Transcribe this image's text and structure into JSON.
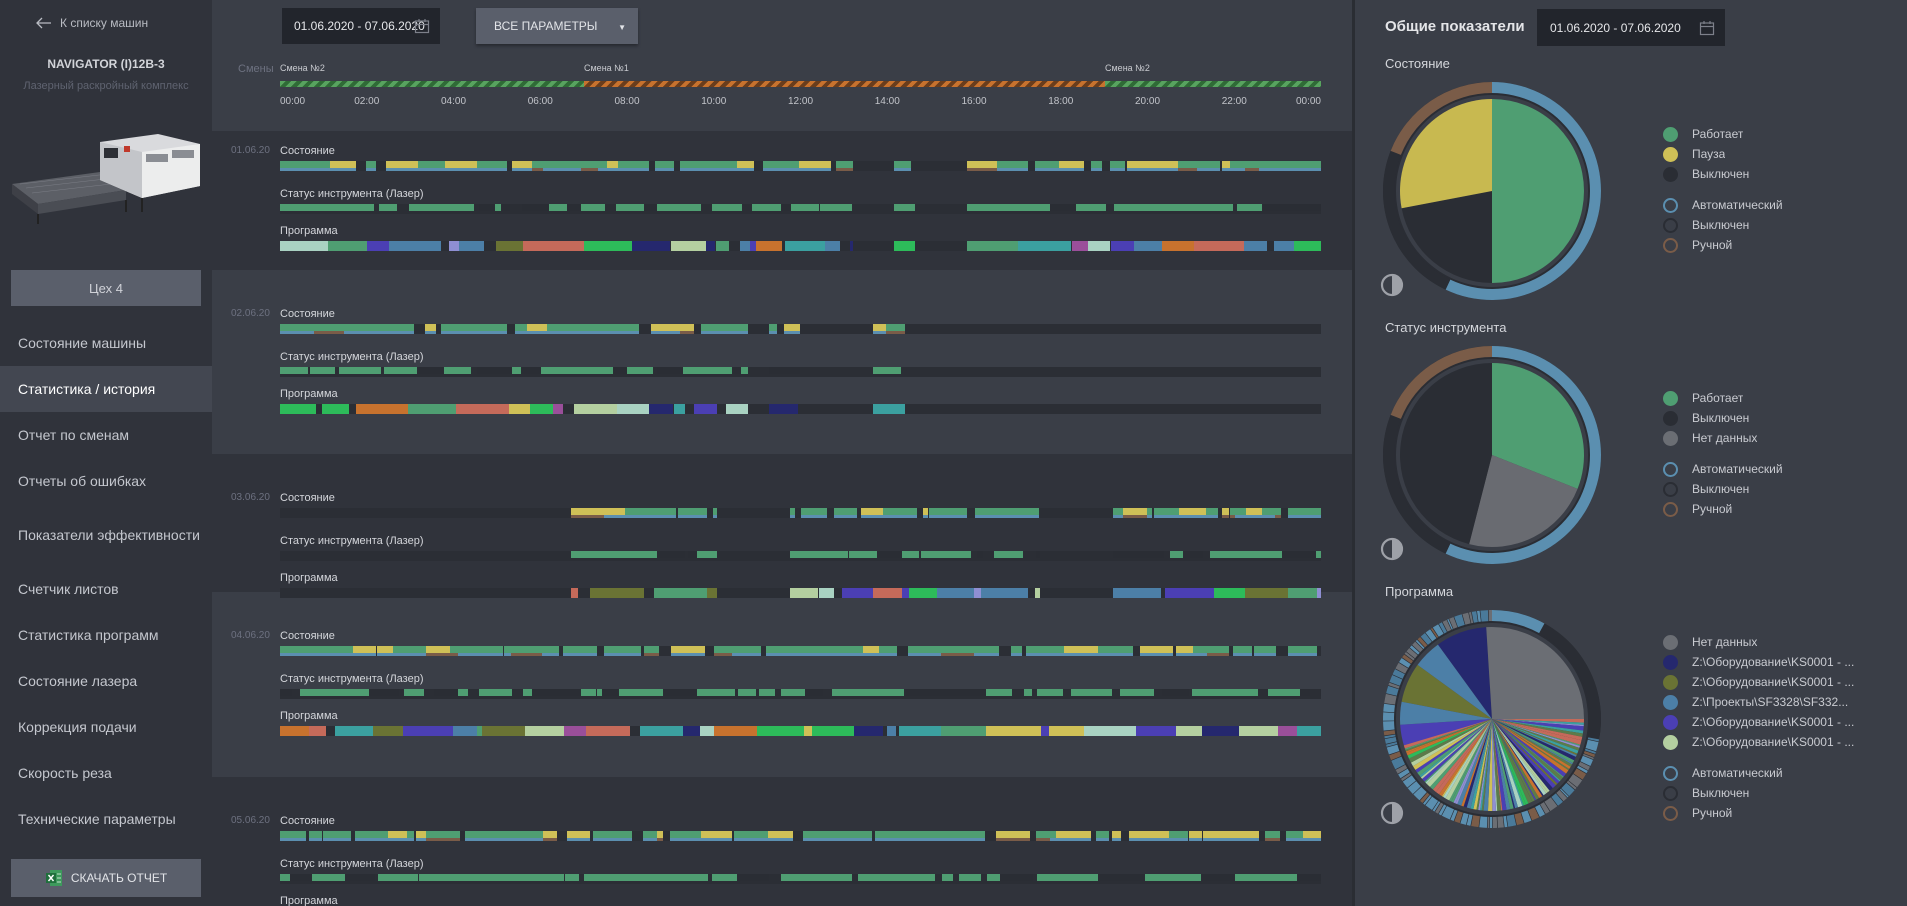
{
  "sidebar": {
    "back_label": "К списку машин",
    "machine_name": "NAVIGATOR (I)12В-3",
    "machine_subtitle": "Лазерный раскройный комплекс",
    "shop_label": "Цех 4",
    "nav": [
      {
        "label": "Состояние машины"
      },
      {
        "label": "Статистика / история"
      },
      {
        "label": "Отчет по сменам"
      },
      {
        "label": "Отчеты об ошибках"
      },
      {
        "label": "Показатели эффективности"
      },
      {
        "label": "Счетчик листов"
      },
      {
        "label": "Статистика программ"
      },
      {
        "label": "Состояние лазера"
      },
      {
        "label": "Коррекция подачи"
      },
      {
        "label": "Скорость реза"
      },
      {
        "label": "Технические параметры"
      }
    ],
    "download_label": "СКАЧАТЬ ОТЧЕТ"
  },
  "toolbar": {
    "date_range": "01.06.2020 - 07.06.2020",
    "params_label": "ВСЕ ПАРАМЕТРЫ"
  },
  "timeline": {
    "shifts_label": "Смены",
    "shift_names": [
      "Смена №2",
      "Смена №1",
      "Смена №2"
    ],
    "hours": [
      "00:00",
      "02:00",
      "04:00",
      "06:00",
      "08:00",
      "10:00",
      "12:00",
      "14:00",
      "16:00",
      "18:00",
      "20:00",
      "22:00",
      "00:00"
    ]
  },
  "days": [
    {
      "date": "01.06.20",
      "rows": [
        "Состояние",
        "Статус инструмента (Лазер)",
        "Программа"
      ]
    },
    {
      "date": "02.06.20",
      "rows": [
        "Состояние",
        "Статус инструмента (Лазер)",
        "Программа"
      ]
    },
    {
      "date": "03.06.20",
      "rows": [
        "Состояние",
        "Статус инструмента (Лазер)",
        "Программа"
      ]
    },
    {
      "date": "04.06.20",
      "rows": [
        "Состояние",
        "Статус инструмента (Лазер)",
        "Программа"
      ]
    },
    {
      "date": "05.06.20",
      "rows": [
        "Состояние",
        "Статус инструмента (Лазер)",
        "Программа"
      ]
    }
  ],
  "summary": {
    "title": "Общие показатели",
    "date_range": "01.06.2020 - 07.06.2020",
    "sections": [
      {
        "title": "Состояние",
        "legend": [
          {
            "label": "Работает",
            "color": "#4f9e72",
            "kind": "dot"
          },
          {
            "label": "Пауза",
            "color": "#cfc057",
            "kind": "dot"
          },
          {
            "label": "Выключен",
            "color": "#2a2d34",
            "kind": "dot"
          }
        ],
        "legend_modes": [
          {
            "label": "Автоматический",
            "color": "#5b8fb0",
            "kind": "ring"
          },
          {
            "label": "Выключен",
            "color": "#2a2d34",
            "kind": "ring"
          },
          {
            "label": "Ручной",
            "color": "#7a5c48",
            "kind": "ring"
          }
        ],
        "pie": [
          {
            "label": "Работает",
            "value": 0.5,
            "color": "#4f9e72"
          },
          {
            "label": "Выключен",
            "value": 0.22,
            "color": "#2a2d34"
          },
          {
            "label": "Пауза",
            "value": 0.28,
            "color": "#c8b950"
          }
        ],
        "outer": [
          {
            "label": "Автоматический",
            "value": 0.57,
            "color": "#5b8fb0"
          },
          {
            "label": "Выключен",
            "value": 0.24,
            "color": "#2a2d34"
          },
          {
            "label": "Ручной",
            "value": 0.19,
            "color": "#7a5c48"
          }
        ]
      },
      {
        "title": "Статус инструмента",
        "legend": [
          {
            "label": "Работает",
            "color": "#4f9e72",
            "kind": "dot"
          },
          {
            "label": "Выключен",
            "color": "#2a2d34",
            "kind": "dot"
          },
          {
            "label": "Нет данных",
            "color": "#6b6e74",
            "kind": "dot"
          }
        ],
        "legend_modes": [
          {
            "label": "Автоматический",
            "color": "#5b8fb0",
            "kind": "ring"
          },
          {
            "label": "Выключен",
            "color": "#2a2d34",
            "kind": "ring"
          },
          {
            "label": "Ручной",
            "color": "#7a5c48",
            "kind": "ring"
          }
        ],
        "pie": [
          {
            "label": "Работает",
            "value": 0.31,
            "color": "#4f9e72"
          },
          {
            "label": "Нет данных",
            "value": 0.23,
            "color": "#696b71"
          },
          {
            "label": "Выключен",
            "value": 0.46,
            "color": "#2a2d34"
          }
        ],
        "outer": [
          {
            "label": "Автоматический",
            "value": 0.57,
            "color": "#5b8fb0"
          },
          {
            "label": "Выключен",
            "value": 0.24,
            "color": "#2a2d34"
          },
          {
            "label": "Ручной",
            "value": 0.19,
            "color": "#7a5c48"
          }
        ]
      },
      {
        "title": "Программа",
        "legend": [
          {
            "label": "Нет данных",
            "color": "#6b6e74",
            "kind": "dot"
          },
          {
            "label": "Z:\\Оборудование\\KS0001 - ...",
            "color": "#25286e",
            "kind": "dot"
          },
          {
            "label": "Z:\\Оборудование\\KS0001 - ...",
            "color": "#6a7334",
            "kind": "dot"
          },
          {
            "label": "Z:\\Проекты\\SF3328\\SF332...",
            "color": "#4c7fa7",
            "kind": "dot"
          },
          {
            "label": "Z:\\Оборудование\\KS0001 - ...",
            "color": "#4b3fb4",
            "kind": "dot"
          },
          {
            "label": "Z:\\Оборудование\\KS0001 - ...",
            "color": "#b4cfa0",
            "kind": "dot"
          }
        ],
        "legend_modes": [
          {
            "label": "Автоматический",
            "color": "#5b8fb0",
            "kind": "ring"
          },
          {
            "label": "Выключен",
            "color": "#2a2d34",
            "kind": "ring"
          },
          {
            "label": "Ручной",
            "color": "#7a5c48",
            "kind": "ring"
          }
        ]
      }
    ]
  },
  "colors": {
    "work": "#4f9e72",
    "pause": "#cfc057",
    "off": "#2a2d34",
    "auto": "#5b8fb0",
    "manual": "#7a5c48",
    "nodata": "#6b6e74"
  }
}
